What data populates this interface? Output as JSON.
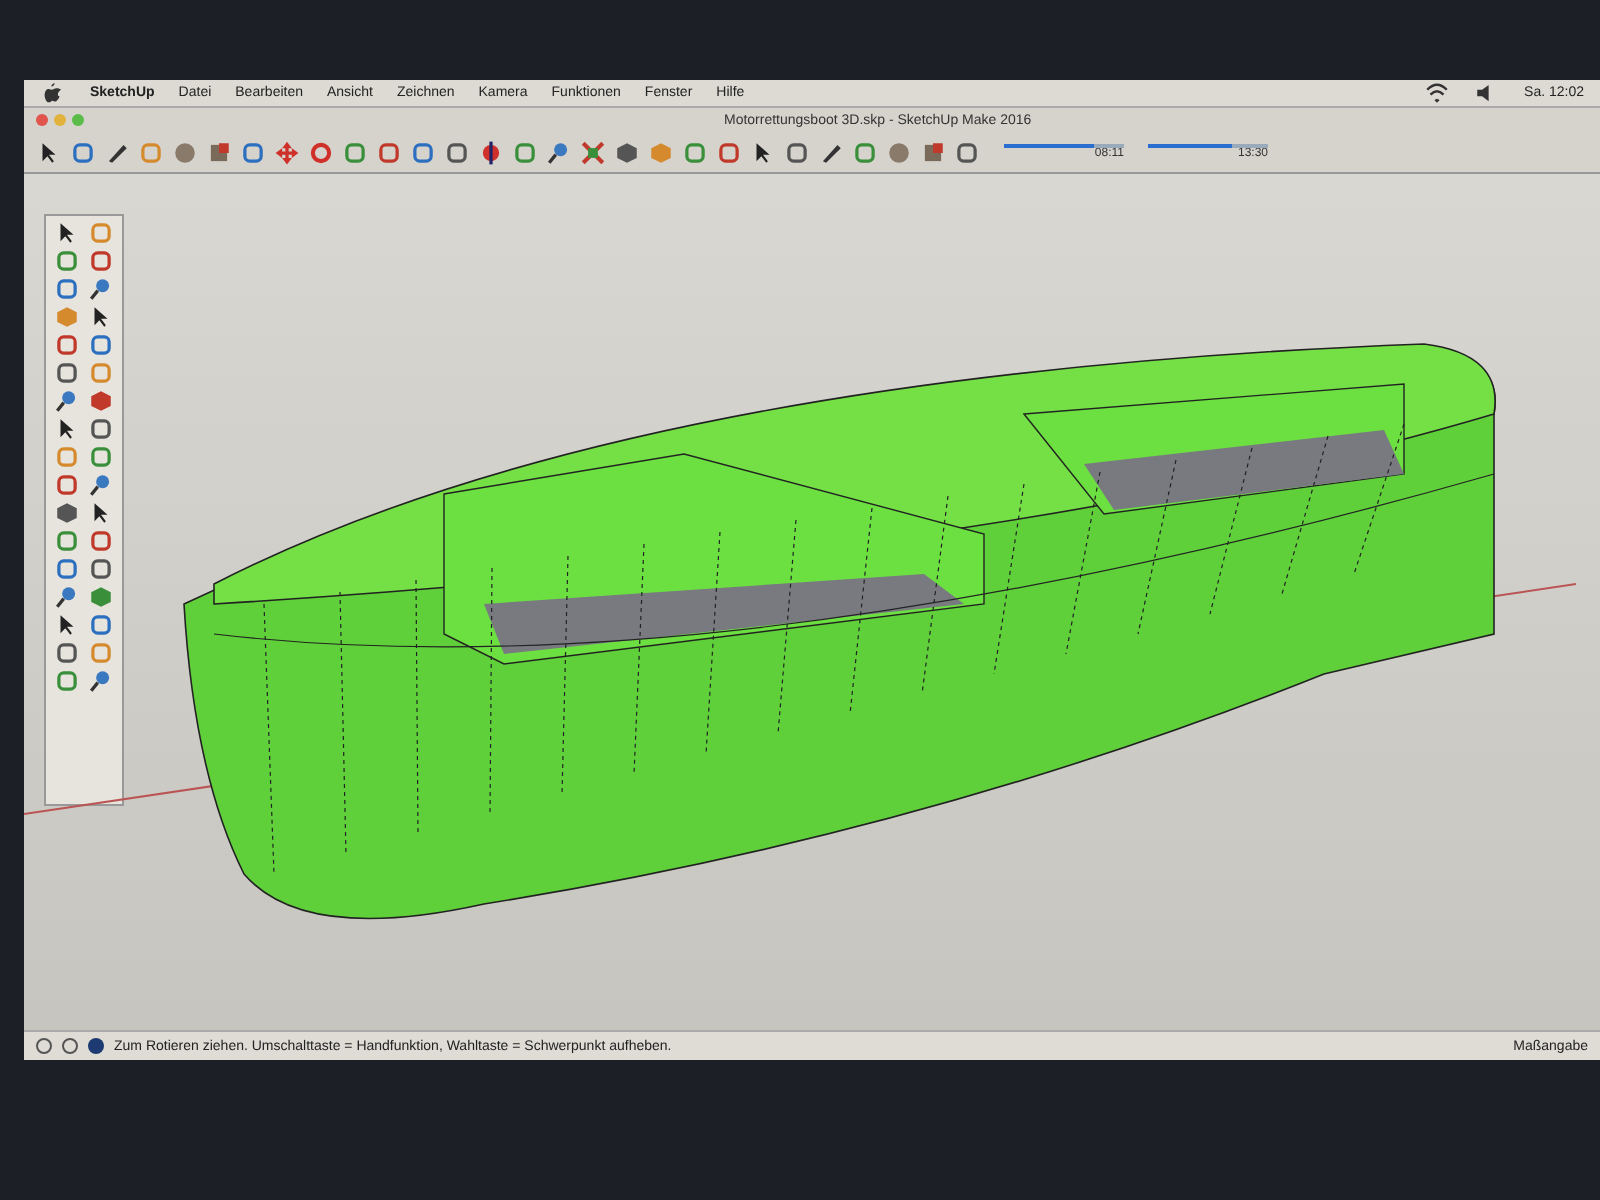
{
  "menu_bar": {
    "app_name": "SketchUp",
    "menus": [
      "Datei",
      "Bearbeiten",
      "Ansicht",
      "Zeichnen",
      "Kamera",
      "Funktionen",
      "Fenster",
      "Hilfe"
    ],
    "clock": "Sa. 12:02"
  },
  "window": {
    "title": "Motorrettungsboot 3D.skp - SketchUp Make 2016"
  },
  "shadow_sliders": [
    {
      "level": 0.75,
      "reading": "08:11"
    },
    {
      "level": 0.7,
      "reading": "13:30"
    }
  ],
  "status_bar": {
    "hint": "Zum Rotieren ziehen. Umschalttaste = Handfunktion, Wahltaste = Schwerpunkt aufheben.",
    "measurement_label": "Maßangabe"
  }
}
